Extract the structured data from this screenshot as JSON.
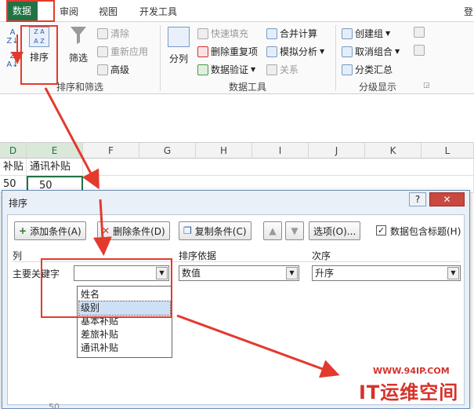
{
  "ribbon": {
    "tabs": [
      "数据",
      "审阅",
      "视图",
      "开发工具"
    ],
    "right_fragment": "登",
    "sort_filter": {
      "sort_label": "排序",
      "filter_label": "筛选",
      "clear_label": "清除",
      "reapply_label": "重新应用",
      "advanced_label": "高级",
      "group_label": "排序和筛选"
    },
    "data_tools": {
      "split_label": "分列",
      "flash_fill_label": "快速填充",
      "remove_dup_label": "删除重复项",
      "validation_label": "数据验证",
      "consolidate_label": "合并计算",
      "whatif_label": "模拟分析",
      "relations_label": "关系",
      "group_label": "数据工具"
    },
    "outline": {
      "create_group_label": "创建组",
      "ungroup_label": "取消组合",
      "subtotal_label": "分类汇总",
      "group_label": "分级显示"
    }
  },
  "grid": {
    "columns": [
      "D",
      "E",
      "F",
      "G",
      "H",
      "I",
      "J",
      "K",
      "L"
    ],
    "row1": [
      "补贴",
      "通讯补贴"
    ],
    "row2": [
      "50",
      "50"
    ],
    "bottom_fragment": "50"
  },
  "dialog": {
    "title": "排序",
    "help": "?",
    "close": "✕",
    "add_label": "添加条件(A)",
    "delete_label": "删除条件(D)",
    "copy_label": "复制条件(C)",
    "up_arrow": "▲",
    "down_arrow": "▼",
    "options_label": "选项(O)...",
    "has_header_checked": "✓",
    "has_header_label": "数据包含标题(H)",
    "col_header": "列",
    "basis_header": "排序依据",
    "order_header": "次序",
    "primary_key_label": "主要关键字",
    "key_value": "",
    "basis_value": "数值",
    "order_value": "升序",
    "dropdown_options": [
      "姓名",
      "级别",
      "基本补贴",
      "差旅补贴",
      "通讯补贴"
    ]
  },
  "watermark": {
    "url": "WWW.94IP.COM",
    "text": "IT运维空间"
  }
}
